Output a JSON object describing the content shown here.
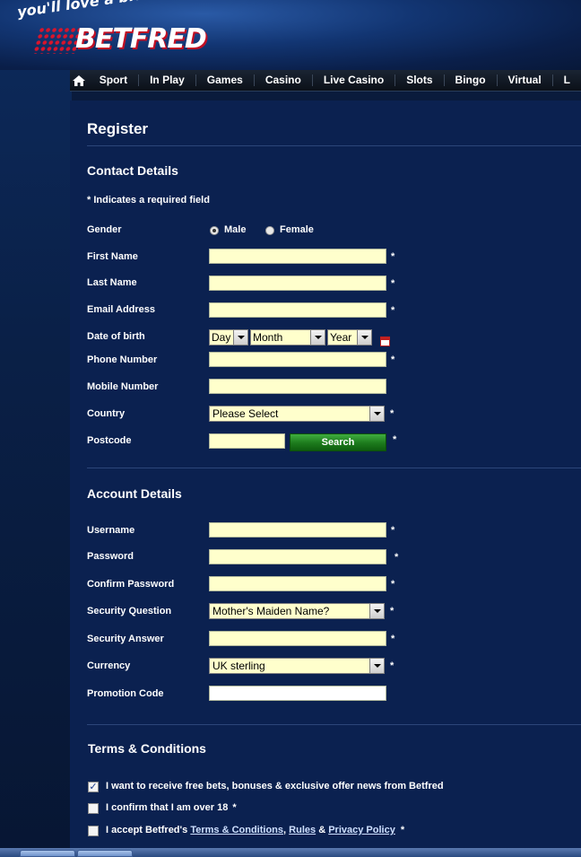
{
  "header": {
    "tagline": "you'll love a bit of...",
    "logo_text": "BETFRED"
  },
  "nav": {
    "items": [
      "Sport",
      "In Play",
      "Games",
      "Casino",
      "Live Casino",
      "Slots",
      "Bingo",
      "Virtual",
      "L"
    ]
  },
  "page": {
    "title": "Register",
    "contact_heading": "Contact Details",
    "required_note": "* Indicates a required field",
    "account_heading": "Account Details",
    "terms_heading": "Terms & Conditions"
  },
  "contact": {
    "gender_label": "Gender",
    "gender_male": "Male",
    "gender_female": "Female",
    "first_name_label": "First Name",
    "last_name_label": "Last Name",
    "email_label": "Email Address",
    "dob_label": "Date of birth",
    "dob_day": "Day",
    "dob_month": "Month",
    "dob_year": "Year",
    "phone_label": "Phone Number",
    "mobile_label": "Mobile Number",
    "country_label": "Country",
    "country_value": "Please Select",
    "postcode_label": "Postcode",
    "search_label": "Search"
  },
  "account": {
    "username_label": "Username",
    "password_label": "Password",
    "confirm_password_label": "Confirm Password",
    "security_question_label": "Security Question",
    "security_question_value": "Mother's Maiden Name?",
    "security_answer_label": "Security Answer",
    "currency_label": "Currency",
    "currency_value": "UK sterling",
    "promo_label": "Promotion Code"
  },
  "terms": {
    "offers_label": "I want to receive free bets, bonuses & exclusive offer news from Betfred",
    "age_label": "I confirm that I am over 18",
    "accept_prefix": "I accept Betfred's",
    "terms_link": "Terms & Conditions",
    "comma": ",",
    "rules_link": "Rules",
    "amp": "&",
    "privacy_link": "Privacy Policy"
  },
  "required_star": "*",
  "colors": {
    "background": "#0b2150",
    "field": "#ffffcc",
    "search_button": "#1c7a1c",
    "logo_accent": "#d9142b"
  }
}
